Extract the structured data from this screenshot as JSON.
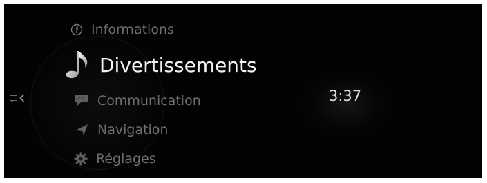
{
  "menu": {
    "items": [
      {
        "label": "Informations",
        "icon": "info-icon",
        "active": false
      },
      {
        "label": "Divertissements",
        "icon": "music-note-icon",
        "active": true
      },
      {
        "label": "Communication",
        "icon": "chat-bubble-icon",
        "active": false
      },
      {
        "label": "Navigation",
        "icon": "navigation-arrow-icon",
        "active": false
      },
      {
        "label": "Réglages",
        "icon": "gear-icon",
        "active": false
      }
    ]
  },
  "status": {
    "time": "3:37"
  },
  "colors": {
    "background": "#020202",
    "active_text": "#f2f2f2",
    "inactive_text": "#6e6e6e"
  }
}
